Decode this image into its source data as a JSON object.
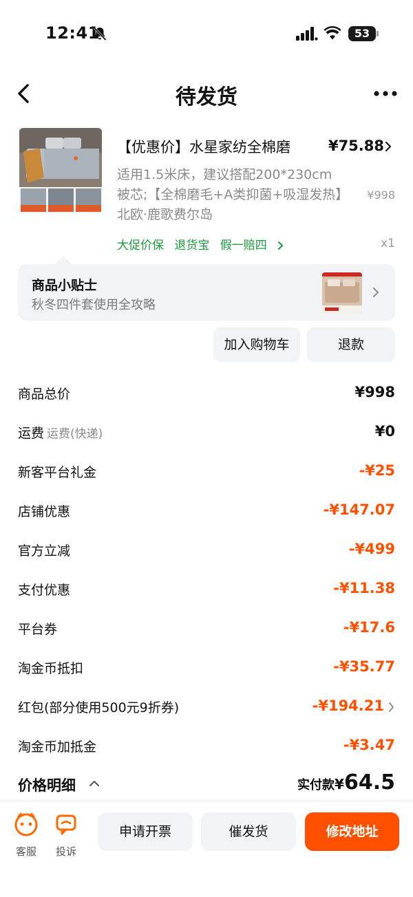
{
  "status_bar": {
    "time": "12:41",
    "battery": "53"
  },
  "nav": {
    "title": "待发货"
  },
  "product": {
    "title": "【优惠价】水星家纺全棉磨",
    "price": "¥75.88",
    "spec": "适用1.5米床，建议搭配200*230cm被芯;【全棉磨毛+A类抑菌+吸湿发热】北欧·鹿歌费尔岛",
    "original_price": "¥998",
    "tags": [
      "大促价保",
      "退货宝",
      "假一赔四"
    ],
    "qty": "x1",
    "thumb_labels": [
      "A面（被面）",
      "B面（被底）",
      "全棉磨毛面料"
    ]
  },
  "tips": {
    "title": "商品小贴士",
    "subtitle": "秋冬四件套使用全攻略"
  },
  "actions": {
    "add_cart": "加入购物车",
    "refund": "退款"
  },
  "price_rows": [
    {
      "label": "商品总价",
      "sub": "",
      "value": "¥998",
      "negative": false
    },
    {
      "label": "运费",
      "sub": "运费(快递)",
      "value": "¥0",
      "negative": false
    },
    {
      "label": "新客平台礼金",
      "sub": "",
      "value": "-¥25",
      "negative": true
    },
    {
      "label": "店铺优惠",
      "sub": "",
      "value": "-¥147.07",
      "negative": true
    },
    {
      "label": "官方立减",
      "sub": "",
      "value": "-¥499",
      "negative": true
    },
    {
      "label": "支付优惠",
      "sub": "",
      "value": "-¥11.38",
      "negative": true
    },
    {
      "label": "平台券",
      "sub": "",
      "value": "-¥17.6",
      "negative": true
    },
    {
      "label": "淘金币抵扣",
      "sub": "",
      "value": "-¥35.77",
      "negative": true
    },
    {
      "label": "红包(部分使用500元9折券)",
      "sub": "",
      "value": "-¥194.21",
      "negative": true
    },
    {
      "label": "淘金币加抵金",
      "sub": "",
      "value": "-¥3.47",
      "negative": true
    }
  ],
  "summary": {
    "detail_label": "价格明细",
    "total_label": "实付款",
    "currency": "¥",
    "total": "64.5"
  },
  "bottom": {
    "service": "客服",
    "complaint": "投诉",
    "invoice": "申请开票",
    "urge": "催发货",
    "modify_address": "修改地址"
  },
  "colors": {
    "accent": "#ff5000",
    "green": "#1a9c3c",
    "card_bg": "#f1f3f5"
  }
}
